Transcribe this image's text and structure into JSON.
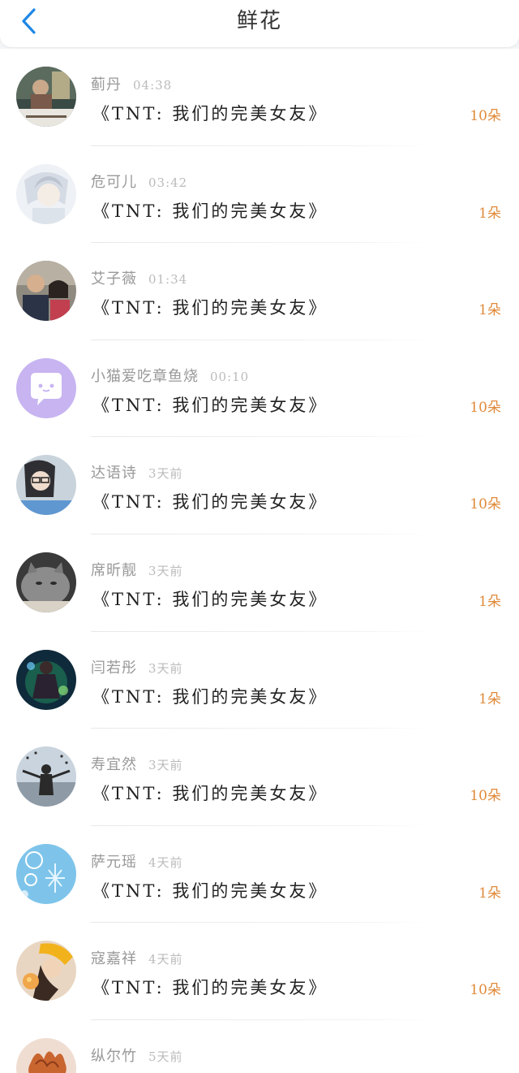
{
  "header": {
    "title": "鲜花",
    "back_icon": "chevron-left-icon",
    "accent_color": "#1e88e5"
  },
  "count_color": "#e08a3a",
  "gifts": [
    {
      "name": "蓟丹",
      "time": "04:38",
      "movie": "《TNT: 我们的完美女友》",
      "count": "10朵",
      "avatar": "avatar-1"
    },
    {
      "name": "危可儿",
      "time": "03:42",
      "movie": "《TNT: 我们的完美女友》",
      "count": "1朵",
      "avatar": "avatar-2"
    },
    {
      "name": "艾子薇",
      "time": "01:34",
      "movie": "《TNT: 我们的完美女友》",
      "count": "1朵",
      "avatar": "avatar-3"
    },
    {
      "name": "小猫爱吃章鱼烧",
      "time": "00:10",
      "movie": "《TNT: 我们的完美女友》",
      "count": "10朵",
      "avatar": "avatar-4"
    },
    {
      "name": "达语诗",
      "time": "3天前",
      "movie": "《TNT: 我们的完美女友》",
      "count": "10朵",
      "avatar": "avatar-5"
    },
    {
      "name": "席昕靓",
      "time": "3天前",
      "movie": "《TNT: 我们的完美女友》",
      "count": "1朵",
      "avatar": "avatar-6"
    },
    {
      "name": "闫若彤",
      "time": "3天前",
      "movie": "《TNT: 我们的完美女友》",
      "count": "1朵",
      "avatar": "avatar-7"
    },
    {
      "name": "寿宜然",
      "time": "3天前",
      "movie": "《TNT: 我们的完美女友》",
      "count": "10朵",
      "avatar": "avatar-8"
    },
    {
      "name": "萨元瑶",
      "time": "4天前",
      "movie": "《TNT: 我们的完美女友》",
      "count": "1朵",
      "avatar": "avatar-9"
    },
    {
      "name": "寇嘉祥",
      "time": "4天前",
      "movie": "《TNT: 我们的完美女友》",
      "count": "10朵",
      "avatar": "avatar-10"
    },
    {
      "name": "纵尔竹",
      "time": "5天前",
      "movie": "",
      "count": "",
      "avatar": "avatar-11"
    }
  ]
}
